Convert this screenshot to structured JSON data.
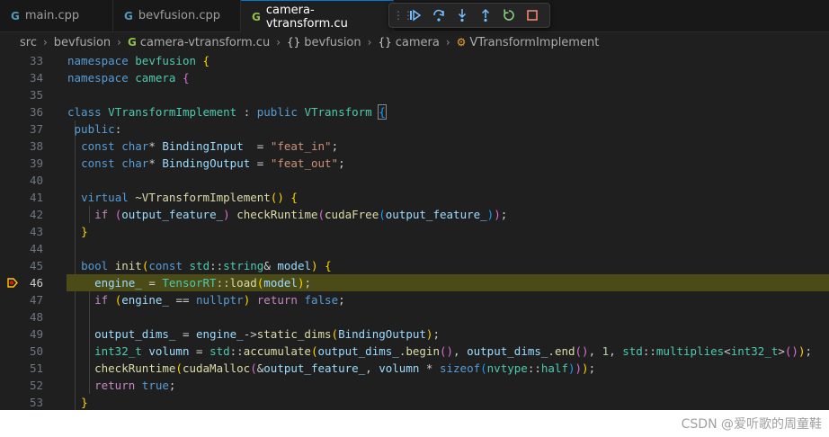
{
  "tabs": [
    {
      "label": "main.cpp",
      "icon": "cpp-file-icon",
      "active": false
    },
    {
      "label": "bevfusion.cpp",
      "icon": "cpp-file-icon",
      "active": false
    },
    {
      "label": "camera-vtransform.cu",
      "icon": "cuda-file-icon",
      "active": true
    }
  ],
  "debug_toolbar": {
    "buttons": [
      "continue",
      "step-over",
      "step-into",
      "step-out",
      "restart",
      "stop"
    ],
    "colors": {
      "continue": "#75beff",
      "restart": "#89d185",
      "stop": "#f48771"
    }
  },
  "breadcrumb": {
    "folder1": "src",
    "folder2": "bevfusion",
    "file": "camera-vtransform.cu",
    "ns1": "bevfusion",
    "ns2": "camera",
    "class": "VTransformImplement"
  },
  "editor": {
    "current_line": 46,
    "lines": [
      {
        "n": "33",
        "text": "namespace bevfusion {"
      },
      {
        "n": "34",
        "text": "namespace camera {"
      },
      {
        "n": "35",
        "text": ""
      },
      {
        "n": "36",
        "text": "class VTransformImplement : public VTransform {"
      },
      {
        "n": "37",
        "text": " public:"
      },
      {
        "n": "38",
        "text": "  const char* BindingInput  = \"feat_in\";"
      },
      {
        "n": "39",
        "text": "  const char* BindingOutput = \"feat_out\";"
      },
      {
        "n": "40",
        "text": ""
      },
      {
        "n": "41",
        "text": "  virtual ~VTransformImplement() {"
      },
      {
        "n": "42",
        "text": "    if (output_feature_) checkRuntime(cudaFree(output_feature_));"
      },
      {
        "n": "43",
        "text": "  }"
      },
      {
        "n": "44",
        "text": ""
      },
      {
        "n": "45",
        "text": "  bool init(const std::string& model) {"
      },
      {
        "n": "46",
        "text": "    engine_ = TensorRT::load(model);"
      },
      {
        "n": "47",
        "text": "    if (engine_ == nullptr) return false;"
      },
      {
        "n": "48",
        "text": ""
      },
      {
        "n": "49",
        "text": "    output_dims_ = engine_->static_dims(BindingOutput);"
      },
      {
        "n": "50",
        "text": "    int32_t volumn = std::accumulate(output_dims_.begin(), output_dims_.end(), 1, std::multiplies<int32_t>());"
      },
      {
        "n": "51",
        "text": "    checkRuntime(cudaMalloc(&output_feature_, volumn * sizeof(nvtype::half)));"
      },
      {
        "n": "52",
        "text": "    return true;"
      },
      {
        "n": "53",
        "text": "  }"
      }
    ]
  },
  "watermark": "CSDN @爱听歌的周童鞋"
}
